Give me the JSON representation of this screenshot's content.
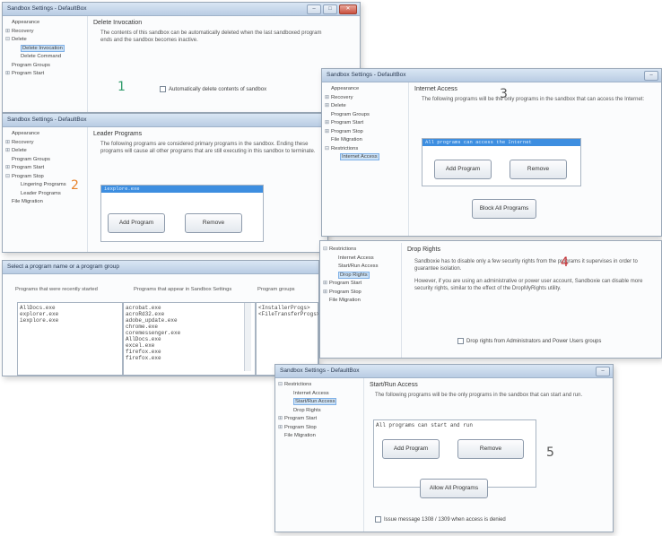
{
  "panel1": {
    "title": "Sandbox Settings - DefaultBox",
    "tree": [
      {
        "label": "Appearance",
        "level": 1,
        "exp": ""
      },
      {
        "label": "Recovery",
        "level": 1,
        "exp": "⊞"
      },
      {
        "label": "Delete",
        "level": 1,
        "exp": "⊟"
      },
      {
        "label": "Delete Invocation",
        "level": 2,
        "exp": "",
        "selected": true
      },
      {
        "label": "Delete Command",
        "level": 2,
        "exp": ""
      },
      {
        "label": "Program Groups",
        "level": 1,
        "exp": ""
      },
      {
        "label": "Program Start",
        "level": 1,
        "exp": "⊞"
      }
    ],
    "heading": "Delete Invocation",
    "text": "The contents of this sandbox can be automatically deleted when the last sandboxed program ends and the sandbox becomes inactive.",
    "checkbox": "Automatically delete contents of sandbox",
    "number": "1",
    "number_color": "#2e9a6a"
  },
  "panel2": {
    "title": "Sandbox Settings - DefaultBox",
    "tree": [
      {
        "label": "Appearance",
        "level": 1,
        "exp": ""
      },
      {
        "label": "Recovery",
        "level": 1,
        "exp": "⊞"
      },
      {
        "label": "Delete",
        "level": 1,
        "exp": "⊞"
      },
      {
        "label": "Program Groups",
        "level": 1,
        "exp": ""
      },
      {
        "label": "Program Start",
        "level": 1,
        "exp": "⊞"
      },
      {
        "label": "Program Stop",
        "level": 1,
        "exp": "⊟"
      },
      {
        "label": "Lingering Programs",
        "level": 2,
        "exp": ""
      },
      {
        "label": "Leader Programs",
        "level": 2,
        "exp": ""
      },
      {
        "label": "File Migration",
        "level": 1,
        "exp": ""
      }
    ],
    "heading": "Leader Programs",
    "text": "The following programs are considered primary programs in the sandbox. Ending these programs will cause all other programs that are still executing in this sandbox to terminate.",
    "list_selected": "iexplore.exe",
    "add_label": "Add Program",
    "remove_label": "Remove",
    "number": "2",
    "number_color": "#e8822a"
  },
  "panel3": {
    "title": "Sandbox Settings - DefaultBox",
    "tree": [
      {
        "label": "Appearance",
        "level": 1,
        "exp": ""
      },
      {
        "label": "Recovery",
        "level": 1,
        "exp": "⊞"
      },
      {
        "label": "Delete",
        "level": 1,
        "exp": "⊞"
      },
      {
        "label": "Program Groups",
        "level": 1,
        "exp": ""
      },
      {
        "label": "Program Start",
        "level": 1,
        "exp": "⊞"
      },
      {
        "label": "Program Stop",
        "level": 1,
        "exp": "⊞"
      },
      {
        "label": "File Migration",
        "level": 1,
        "exp": ""
      },
      {
        "label": "Restrictions",
        "level": 1,
        "exp": "⊟"
      },
      {
        "label": "Internet Access",
        "level": 2,
        "exp": "",
        "selected": true
      }
    ],
    "heading": "Internet Access",
    "text": "The following programs will be the only programs in the sandbox that can access the Internet:",
    "list_selected": "All programs can access the Internet",
    "add_label": "Add Program",
    "remove_label": "Remove",
    "block_label": "Block All Programs",
    "number": "3",
    "number_color": "#555555"
  },
  "panel4": {
    "tree": [
      {
        "label": "Restrictions",
        "level": 1,
        "exp": "⊟"
      },
      {
        "label": "Internet Access",
        "level": 2,
        "exp": ""
      },
      {
        "label": "Start/Run Access",
        "level": 2,
        "exp": ""
      },
      {
        "label": "Drop Rights",
        "level": 2,
        "exp": "",
        "selected": true
      },
      {
        "label": "Program Start",
        "level": 1,
        "exp": "⊞"
      },
      {
        "label": "Program Stop",
        "level": 1,
        "exp": "⊞"
      },
      {
        "label": "File Migration",
        "level": 1,
        "exp": ""
      }
    ],
    "heading": "Drop Rights",
    "text1": "Sandboxie has to disable only a few security rights from the programs it supervises in order to guarantee isolation.",
    "text2": "However, if you are using an administrative or power user account, Sandboxie can disable more security rights, similar to the effect of the DropMyRights utility.",
    "checkbox": "Drop rights from Administrators and Power Users groups",
    "number": "4",
    "number_color": "#c0282d"
  },
  "panel5": {
    "title": "Select a program name or a program group",
    "col1": "Programs that were recently started",
    "col2": "Programs that appear in Sandbox Settings",
    "col3": "Program groups",
    "list1": [
      "AllDocs.exe",
      "explorer.exe",
      "iexplore.exe"
    ],
    "list2": [
      "acrobat.exe",
      "acroRd32.exe",
      "adobe_update.exe",
      "chrome.exe",
      "coremessenger.exe",
      "AllDocs.exe",
      "excel.exe",
      "firefox.exe",
      "firefox.exe"
    ],
    "list3": [
      "<InstallerProgs>",
      "<FileTransferProgs>"
    ]
  },
  "panel6": {
    "title": "Sandbox Settings - DefaultBox",
    "tree": [
      {
        "label": "Restrictions",
        "level": 1,
        "exp": "⊟"
      },
      {
        "label": "Internet Access",
        "level": 2,
        "exp": ""
      },
      {
        "label": "Start/Run Access",
        "level": 2,
        "exp": "",
        "selected": true
      },
      {
        "label": "Drop Rights",
        "level": 2,
        "exp": ""
      },
      {
        "label": "Program Start",
        "level": 1,
        "exp": "⊞"
      },
      {
        "label": "Program Stop",
        "level": 1,
        "exp": "⊞"
      },
      {
        "label": "File Migration",
        "level": 1,
        "exp": ""
      }
    ],
    "heading": "Start/Run Access",
    "text": "The following programs will be the only programs in the sandbox that can start and run.",
    "list_item": "All programs can start and run",
    "add_label": "Add Program",
    "remove_label": "Remove",
    "allow_label": "Allow All Programs",
    "checkbox": "Issue message 1308 / 1309 when access is denied",
    "number": "5",
    "number_color": "#555555"
  }
}
